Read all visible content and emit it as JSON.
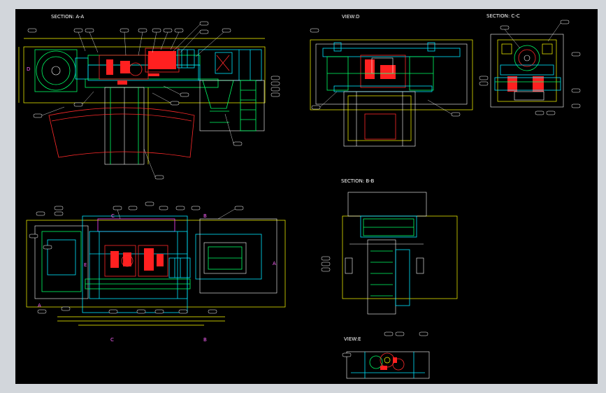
{
  "titles": {
    "section_a": "SECTION: A-A",
    "view_d": "VIEW:D",
    "section_c": "SECTION: C-C",
    "section_b": "SECTION: B-B",
    "view_e": "VIEW:E"
  },
  "markers": {
    "c_top": "C",
    "b_top": "B",
    "a_left": "A",
    "a_right": "A",
    "c_bottom": "C",
    "b_bottom": "B",
    "d_arrow": "D",
    "e_top": "E"
  },
  "colors": {
    "background": "#000000",
    "frame": "#d2d6db",
    "outline": "#00ff66",
    "structure": "#00e5ff",
    "dimension": "#ffff00",
    "highlight": "#ff2020",
    "marker": "#ff44ff"
  }
}
